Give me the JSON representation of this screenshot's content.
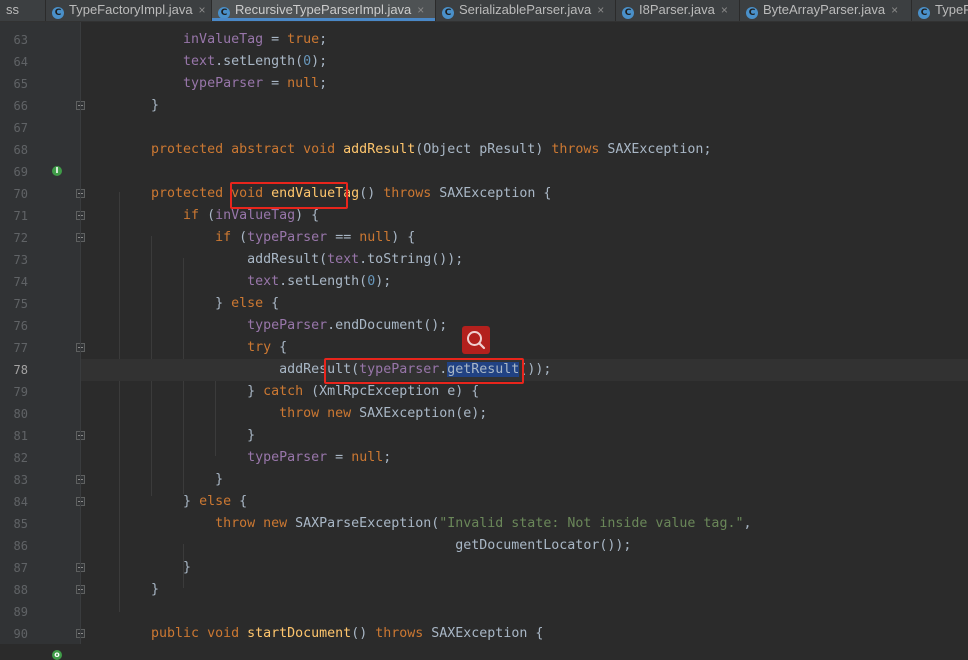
{
  "tabs": [
    {
      "label": "ss",
      "icon": "",
      "active": false
    },
    {
      "label": "TypeFactoryImpl.java",
      "icon": "C",
      "active": false
    },
    {
      "label": "RecursiveTypeParserImpl.java",
      "icon": "C",
      "active": true
    },
    {
      "label": "SerializableParser.java",
      "icon": "C",
      "active": false
    },
    {
      "label": "I8Parser.java",
      "icon": "C",
      "active": false
    },
    {
      "label": "ByteArrayParser.java",
      "icon": "C",
      "active": false
    },
    {
      "label": "TypeP",
      "icon": "C",
      "active": false
    }
  ],
  "close_glyph": "×",
  "current_line": 78,
  "lines": [
    {
      "no": "63",
      "t": [
        [
          "        "
        ],
        [
          "inValueTag",
          "fld"
        ],
        [
          " = "
        ],
        [
          "true",
          "kw"
        ],
        [
          ";"
        ]
      ]
    },
    {
      "no": "64",
      "t": [
        [
          "        "
        ],
        [
          "text",
          "fld"
        ],
        [
          ".setLength("
        ],
        [
          "0",
          "num"
        ],
        [
          ");"
        ]
      ]
    },
    {
      "no": "65",
      "t": [
        [
          "        "
        ],
        [
          "typeParser",
          "fld"
        ],
        [
          " = "
        ],
        [
          "null",
          "kw"
        ],
        [
          ";"
        ]
      ]
    },
    {
      "no": "66",
      "t": [
        [
          "    }"
        ]
      ]
    },
    {
      "no": "67",
      "t": []
    },
    {
      "no": "68",
      "t": [
        [
          "    "
        ],
        [
          "protected abstract void ",
          "kw"
        ],
        [
          "addResult",
          "meth"
        ],
        [
          "(Object pResult) "
        ],
        [
          "throws ",
          "kw"
        ],
        [
          "SAXException;"
        ]
      ]
    },
    {
      "no": "69",
      "t": []
    },
    {
      "no": "70",
      "t": [
        [
          "    "
        ],
        [
          "protected void ",
          "kw"
        ],
        [
          "endValueTag",
          "meth"
        ],
        [
          "() "
        ],
        [
          "throws ",
          "kw"
        ],
        [
          "SAXException {"
        ]
      ]
    },
    {
      "no": "71",
      "t": [
        [
          "        "
        ],
        [
          "if ",
          "kw"
        ],
        [
          "("
        ],
        [
          "inValueTag",
          "fld"
        ],
        [
          ") {"
        ]
      ]
    },
    {
      "no": "72",
      "t": [
        [
          "            "
        ],
        [
          "if ",
          "kw"
        ],
        [
          "("
        ],
        [
          "typeParser",
          "fld"
        ],
        [
          " == "
        ],
        [
          "null",
          "kw"
        ],
        [
          ") {"
        ]
      ]
    },
    {
      "no": "73",
      "t": [
        [
          "                addResult("
        ],
        [
          "text",
          "fld"
        ],
        [
          ".toString());"
        ]
      ]
    },
    {
      "no": "74",
      "t": [
        [
          "                "
        ],
        [
          "text",
          "fld"
        ],
        [
          ".setLength("
        ],
        [
          "0",
          "num"
        ],
        [
          ");"
        ]
      ]
    },
    {
      "no": "75",
      "t": [
        [
          "            } "
        ],
        [
          "else ",
          "kw"
        ],
        [
          "{"
        ]
      ]
    },
    {
      "no": "76",
      "t": [
        [
          "                "
        ],
        [
          "typeParser",
          "fld"
        ],
        [
          ".endDocument();"
        ]
      ]
    },
    {
      "no": "77",
      "t": [
        [
          "                "
        ],
        [
          "try ",
          "kw"
        ],
        [
          "{"
        ]
      ]
    },
    {
      "no": "78",
      "t": [
        [
          "                    addResult("
        ],
        [
          "typeParser",
          "fld"
        ],
        [
          "."
        ],
        [
          "getResult",
          "sel"
        ],
        [
          "());"
        ]
      ]
    },
    {
      "no": "79",
      "t": [
        [
          "                } "
        ],
        [
          "catch ",
          "kw"
        ],
        [
          "(XmlRpcException e) {"
        ]
      ]
    },
    {
      "no": "80",
      "t": [
        [
          "                    "
        ],
        [
          "throw new ",
          "kw"
        ],
        [
          "SAXException(e);"
        ]
      ]
    },
    {
      "no": "81",
      "t": [
        [
          "                }"
        ]
      ]
    },
    {
      "no": "82",
      "t": [
        [
          "                "
        ],
        [
          "typeParser",
          "fld"
        ],
        [
          " = "
        ],
        [
          "null",
          "kw"
        ],
        [
          ";"
        ]
      ]
    },
    {
      "no": "83",
      "t": [
        [
          "            }"
        ]
      ]
    },
    {
      "no": "84",
      "t": [
        [
          "        } "
        ],
        [
          "else ",
          "kw"
        ],
        [
          "{"
        ]
      ]
    },
    {
      "no": "85",
      "t": [
        [
          "            "
        ],
        [
          "throw new ",
          "kw"
        ],
        [
          "SAXParseException("
        ],
        [
          "\"Invalid state: Not inside value tag.\"",
          "str"
        ],
        [
          ","
        ]
      ]
    },
    {
      "no": "86",
      "t": [
        [
          "                                          getDocumentLocator());"
        ]
      ]
    },
    {
      "no": "87",
      "t": [
        [
          "        }"
        ]
      ]
    },
    {
      "no": "88",
      "t": [
        [
          "    }"
        ]
      ]
    },
    {
      "no": "89",
      "t": []
    },
    {
      "no": "90",
      "t": [
        [
          "    "
        ],
        [
          "public void ",
          "kw"
        ],
        [
          "startDocument",
          "meth"
        ],
        [
          "() "
        ],
        [
          "throws ",
          "kw"
        ],
        [
          "SAXException {"
        ]
      ]
    }
  ],
  "colors": {
    "keyword": "#cc7832",
    "field": "#9876aa",
    "number": "#6897bb",
    "string": "#6a8759",
    "method": "#ffc66d",
    "highlight_box": "#e8251c",
    "selection": "#214283"
  },
  "icons": {
    "implementation_marker": "implementation-arrow-icon",
    "search": "search-icon"
  }
}
